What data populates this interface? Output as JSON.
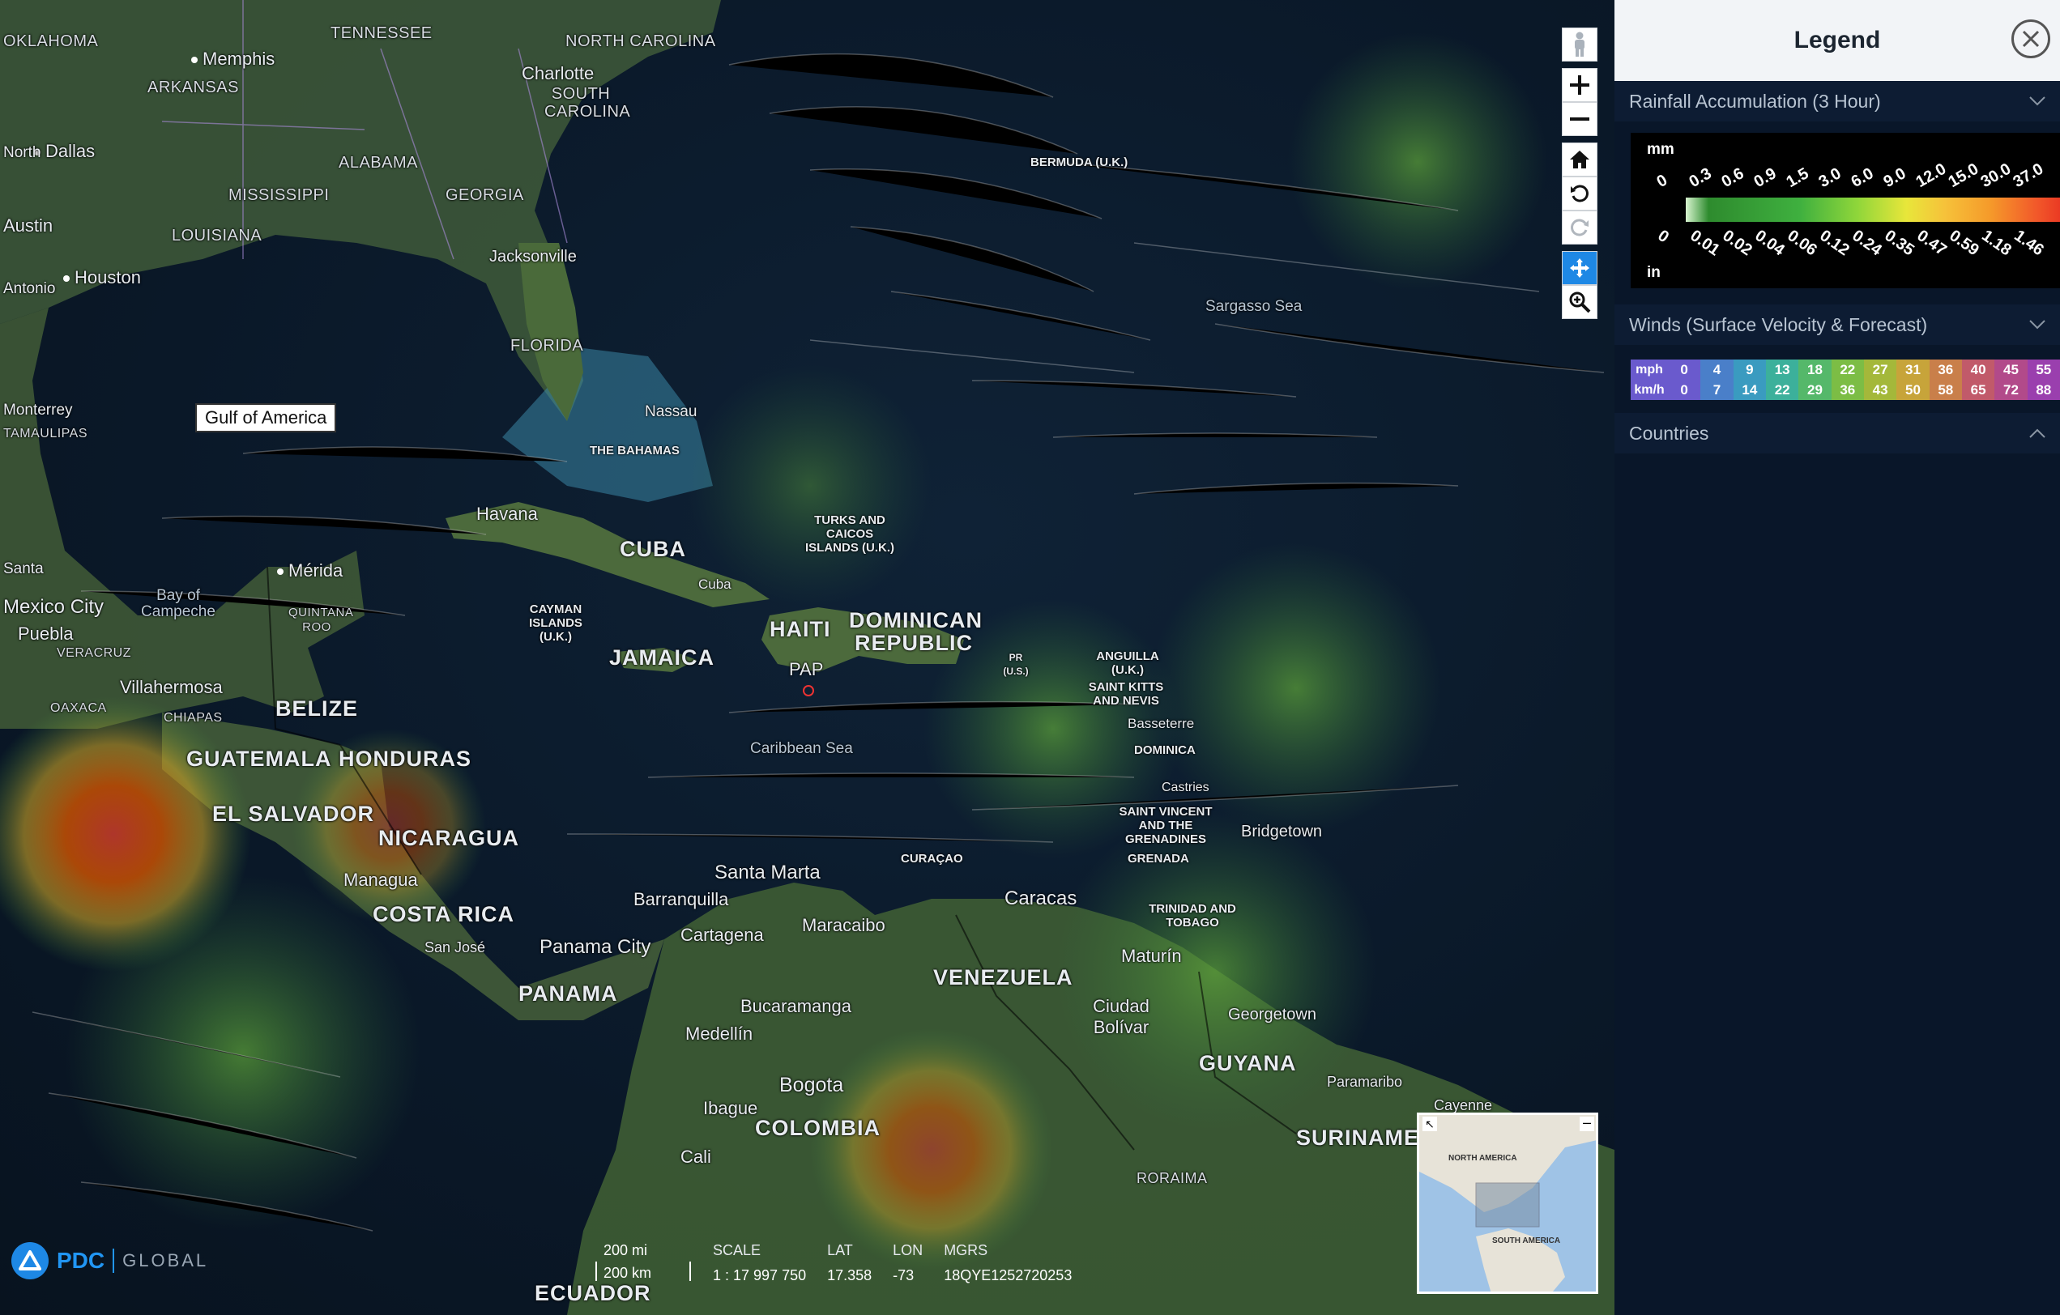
{
  "legend": {
    "title": "Legend",
    "close_icon": "close-circle-icon",
    "sections": {
      "rainfall": {
        "title": "Rainfall Accumulation (3 Hour)",
        "unit_top": "mm",
        "unit_bottom": "in",
        "mm_ticks": [
          "0",
          "0.3",
          "0.6",
          "0.9",
          "1.5",
          "3.0",
          "6.0",
          "9.0",
          "12.0",
          "15.0",
          "30.0",
          "37.0"
        ],
        "in_ticks": [
          "0",
          "0.01",
          "0.02",
          "0.04",
          "0.06",
          "0.12",
          "0.24",
          "0.35",
          "0.47",
          "0.59",
          "1.18",
          "1.46"
        ]
      },
      "winds": {
        "title": "Winds (Surface Velocity & Forecast)",
        "mph_label": "mph",
        "kmh_label": "km/h",
        "mph": [
          "0",
          "4",
          "9",
          "13",
          "18",
          "22",
          "27",
          "31",
          "36",
          "40",
          "45",
          "55"
        ],
        "kmh": [
          "0",
          "7",
          "14",
          "22",
          "29",
          "36",
          "43",
          "50",
          "58",
          "65",
          "72",
          "88"
        ],
        "colors": [
          "#6a5acd",
          "#4a7fc9",
          "#3a9bc0",
          "#3cb09b",
          "#55b86a",
          "#7cbd45",
          "#a4b83a",
          "#c7a43a",
          "#c97f4a",
          "#c15a6a",
          "#b24a8a",
          "#9a3fae"
        ]
      },
      "countries": {
        "title": "Countries"
      }
    }
  },
  "map": {
    "gulf_label": "Gulf of America",
    "countries": [
      "CUBA",
      "HAITI",
      "DOMINICAN REPUBLIC",
      "JAMAICA",
      "BELIZE",
      "GUATEMALA",
      "HONDURAS",
      "EL SALVADOR",
      "NICARAGUA",
      "COSTA RICA",
      "PANAMA",
      "VENEZUELA",
      "COLOMBIA",
      "GUYANA",
      "SURINAME",
      "ECUADOR"
    ],
    "states": [
      "TENNESSEE",
      "NORTH CAROLINA",
      "SOUTH CAROLINA",
      "ARKANSAS",
      "ALABAMA",
      "GEORGIA",
      "MISSISSIPPI",
      "LOUISIANA",
      "FLORIDA",
      "OKLAHOMA",
      "TAMAULIPAS",
      "VERACRUZ",
      "OAXACA",
      "CHIAPAS",
      "QUINTANA ROO",
      "RORAIMA"
    ],
    "cities": [
      "Memphis",
      "Charlotte",
      "Dallas",
      "Austin",
      "Houston",
      "Jacksonville",
      "Nassau",
      "Havana",
      "Mérida",
      "Mexico City",
      "Puebla",
      "Villahermosa",
      "Managua",
      "San José",
      "Panama City",
      "Barranquilla",
      "Cartagena",
      "Santa Marta",
      "Maracaibo",
      "Caracas",
      "Maturín",
      "Ciudad Bolívar",
      "Georgetown",
      "Paramaribo",
      "Cayenne",
      "Bucaramanga",
      "Medellín",
      "Bogota",
      "Ibague",
      "Cali",
      "Bridgetown",
      "Basseterre",
      "Castries",
      "PAP",
      "Cuba",
      "Bay of Campeche",
      "Antonio",
      "Monterrey",
      "Santa",
      "North"
    ],
    "islands": [
      "BERMUDA (U.K.)",
      "THE BAHAMAS",
      "TURKS AND CAICOS ISLANDS (U.K.)",
      "CAYMAN ISLANDS (U.K.)",
      "ANGUILLA (U.K.)",
      "SAINT KITTS AND NEVIS",
      "DOMINICA",
      "SAINT VINCENT AND THE GRENADINES",
      "GRENADA",
      "TRINIDAD AND TOBAGO",
      "PR (U.S.)",
      "CURAÇAO"
    ],
    "seas": [
      "Sargasso Sea",
      "Caribbean Sea"
    ],
    "controls": [
      "pegman-icon",
      "zoom-in-icon",
      "zoom-out-icon",
      "home-icon",
      "rotate-left-icon",
      "rotate-right-icon",
      "pan-icon",
      "zoom-box-icon"
    ],
    "minimap": {
      "north_america": "NORTH AMERICA",
      "south_america": "SOUTH AMERICA"
    }
  },
  "status": {
    "scale_mi": "200 mi",
    "scale_km": "200 km",
    "scale_header": "SCALE",
    "scale_value": "1 : 17 997 750",
    "lat_header": "LAT",
    "lat_value": "17.358",
    "lon_header": "LON",
    "lon_value": "-73",
    "mgrs_header": "MGRS",
    "mgrs_value": "18QYE1252720253"
  },
  "brand": {
    "pdc": "PDC",
    "global": "GLOBAL"
  }
}
